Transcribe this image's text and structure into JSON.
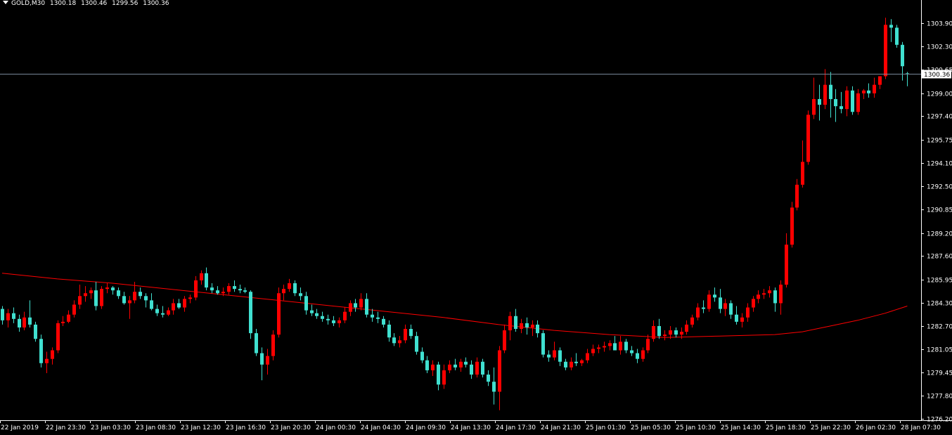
{
  "header": {
    "symbol": "GOLD,M30",
    "open": "1300.18",
    "high": "1300.46",
    "low": "1299.56",
    "close": "1300.36"
  },
  "colors": {
    "background": "#000000",
    "bull": "#ff0000",
    "bear": "#40e0d0",
    "moving_average": "#ff0000",
    "bid_line": "#778899",
    "axis": "#ffffff",
    "text": "#ffffff"
  },
  "chart_data": {
    "type": "candlestick",
    "symbol": "GOLD",
    "timeframe": "M30",
    "ylim": [
      1276.2,
      1304.9
    ],
    "y_ticks": [
      "1303.90",
      "1302.30",
      "1300.65",
      "1299.00",
      "1297.40",
      "1295.75",
      "1294.10",
      "1292.50",
      "1290.85",
      "1289.20",
      "1287.60",
      "1285.95",
      "1284.30",
      "1282.70",
      "1281.05",
      "1279.45",
      "1277.80",
      "1276.20"
    ],
    "x_ticks": [
      "22 Jan 2019",
      "22 Jan 23:30",
      "23 Jan 03:30",
      "23 Jan 08:30",
      "23 Jan 12:30",
      "23 Jan 16:30",
      "23 Jan 20:30",
      "24 Jan 00:30",
      "24 Jan 04:30",
      "24 Jan 09:30",
      "24 Jan 13:30",
      "24 Jan 17:30",
      "24 Jan 21:30",
      "25 Jan 01:30",
      "25 Jan 05:30",
      "25 Jan 10:30",
      "25 Jan 14:30",
      "25 Jan 18:30",
      "25 Jan 22:30",
      "26 Jan 02:30",
      "28 Jan 07:30"
    ],
    "current_price": "1300.36",
    "candles": [
      [
        1283.9,
        1284.1,
        1282.8,
        1283.1
      ],
      [
        1283.1,
        1283.9,
        1282.6,
        1283.6
      ],
      [
        1283.6,
        1284.0,
        1282.9,
        1283.2
      ],
      [
        1283.2,
        1283.5,
        1282.3,
        1282.6
      ],
      [
        1282.6,
        1283.7,
        1282.4,
        1283.3
      ],
      [
        1283.3,
        1284.5,
        1282.6,
        1282.8
      ],
      [
        1282.8,
        1283.0,
        1281.6,
        1281.8
      ],
      [
        1281.8,
        1282.1,
        1279.8,
        1280.1
      ],
      [
        1280.1,
        1280.9,
        1279.4,
        1280.4
      ],
      [
        1280.4,
        1281.2,
        1280.0,
        1281.0
      ],
      [
        1281.0,
        1283.1,
        1280.8,
        1282.9
      ],
      [
        1282.9,
        1283.4,
        1282.7,
        1283.0
      ],
      [
        1283.0,
        1283.8,
        1282.9,
        1283.5
      ],
      [
        1283.5,
        1284.5,
        1283.3,
        1284.2
      ],
      [
        1284.2,
        1285.6,
        1283.9,
        1284.8
      ],
      [
        1284.8,
        1285.5,
        1284.4,
        1285.0
      ],
      [
        1285.0,
        1285.4,
        1284.6,
        1285.2
      ],
      [
        1285.2,
        1285.8,
        1283.8,
        1284.1
      ],
      [
        1284.1,
        1285.5,
        1283.9,
        1285.3
      ],
      [
        1285.3,
        1285.7,
        1285.0,
        1285.4
      ],
      [
        1285.4,
        1285.5,
        1284.9,
        1285.2
      ],
      [
        1285.2,
        1285.4,
        1284.6,
        1284.8
      ],
      [
        1284.8,
        1285.1,
        1284.2,
        1284.3
      ],
      [
        1284.3,
        1284.8,
        1283.2,
        1284.5
      ],
      [
        1284.5,
        1285.8,
        1284.3,
        1285.1
      ],
      [
        1285.1,
        1285.4,
        1284.6,
        1284.8
      ],
      [
        1284.8,
        1285.0,
        1284.0,
        1284.5
      ],
      [
        1284.5,
        1285.0,
        1283.8,
        1283.9
      ],
      [
        1283.9,
        1284.2,
        1283.4,
        1283.6
      ],
      [
        1283.6,
        1284.1,
        1283.3,
        1283.5
      ],
      [
        1283.5,
        1284.0,
        1283.4,
        1283.8
      ],
      [
        1283.8,
        1284.6,
        1283.5,
        1284.3
      ],
      [
        1284.3,
        1284.6,
        1283.9,
        1284.0
      ],
      [
        1284.0,
        1284.8,
        1283.7,
        1284.6
      ],
      [
        1284.6,
        1284.9,
        1284.3,
        1284.7
      ],
      [
        1284.7,
        1286.2,
        1284.5,
        1285.9
      ],
      [
        1285.9,
        1286.6,
        1285.6,
        1286.4
      ],
      [
        1286.4,
        1286.8,
        1285.2,
        1285.4
      ],
      [
        1285.4,
        1285.7,
        1285.0,
        1285.2
      ],
      [
        1285.2,
        1285.5,
        1284.9,
        1285.0
      ],
      [
        1285.0,
        1285.4,
        1284.8,
        1285.1
      ],
      [
        1285.1,
        1285.7,
        1284.9,
        1285.5
      ],
      [
        1285.5,
        1285.9,
        1285.1,
        1285.3
      ],
      [
        1285.3,
        1285.6,
        1285.0,
        1285.2
      ],
      [
        1285.2,
        1285.4,
        1285.0,
        1285.1
      ],
      [
        1285.1,
        1285.2,
        1281.8,
        1282.2
      ],
      [
        1282.2,
        1282.5,
        1280.6,
        1280.8
      ],
      [
        1280.8,
        1281.2,
        1278.9,
        1280.0
      ],
      [
        1280.0,
        1281.1,
        1279.3,
        1280.6
      ],
      [
        1280.6,
        1282.4,
        1280.3,
        1282.1
      ],
      [
        1282.1,
        1285.4,
        1281.9,
        1285.0
      ],
      [
        1285.0,
        1285.6,
        1284.5,
        1285.3
      ],
      [
        1285.3,
        1286.0,
        1285.1,
        1285.7
      ],
      [
        1285.7,
        1285.9,
        1284.8,
        1285.0
      ],
      [
        1285.0,
        1285.4,
        1284.5,
        1284.8
      ],
      [
        1284.8,
        1285.1,
        1283.5,
        1283.8
      ],
      [
        1283.8,
        1284.2,
        1283.4,
        1283.6
      ],
      [
        1283.6,
        1283.9,
        1283.2,
        1283.4
      ],
      [
        1283.4,
        1283.7,
        1283.0,
        1283.2
      ],
      [
        1283.2,
        1283.5,
        1282.8,
        1283.1
      ],
      [
        1283.1,
        1283.4,
        1282.7,
        1282.9
      ],
      [
        1282.9,
        1283.3,
        1282.6,
        1283.1
      ],
      [
        1283.1,
        1284.0,
        1282.9,
        1283.7
      ],
      [
        1283.7,
        1284.5,
        1283.4,
        1284.3
      ],
      [
        1284.3,
        1284.6,
        1283.7,
        1284.0
      ],
      [
        1284.0,
        1285.0,
        1283.8,
        1284.6
      ],
      [
        1284.6,
        1285.0,
        1283.3,
        1283.5
      ],
      [
        1283.5,
        1283.9,
        1283.0,
        1283.3
      ],
      [
        1283.3,
        1283.7,
        1282.9,
        1283.2
      ],
      [
        1283.2,
        1283.4,
        1282.6,
        1282.8
      ],
      [
        1282.8,
        1283.1,
        1281.6,
        1281.9
      ],
      [
        1281.9,
        1282.2,
        1281.3,
        1281.5
      ],
      [
        1281.5,
        1282.0,
        1281.2,
        1281.7
      ],
      [
        1281.7,
        1282.8,
        1281.5,
        1282.5
      ],
      [
        1282.5,
        1282.8,
        1281.8,
        1282.0
      ],
      [
        1282.0,
        1282.3,
        1280.7,
        1280.9
      ],
      [
        1280.9,
        1281.2,
        1280.1,
        1280.3
      ],
      [
        1280.3,
        1280.6,
        1279.4,
        1279.6
      ],
      [
        1279.6,
        1280.3,
        1279.2,
        1280.0
      ],
      [
        1280.0,
        1280.2,
        1278.2,
        1278.6
      ],
      [
        1278.6,
        1280.0,
        1278.3,
        1279.6
      ],
      [
        1279.6,
        1280.3,
        1279.4,
        1280.0
      ],
      [
        1280.0,
        1280.4,
        1279.6,
        1279.8
      ],
      [
        1279.8,
        1280.4,
        1279.5,
        1280.2
      ],
      [
        1280.2,
        1280.5,
        1279.8,
        1280.0
      ],
      [
        1280.0,
        1280.3,
        1279.0,
        1279.3
      ],
      [
        1279.3,
        1280.5,
        1279.1,
        1280.2
      ],
      [
        1280.2,
        1280.4,
        1279.1,
        1279.3
      ],
      [
        1279.3,
        1279.6,
        1278.5,
        1278.8
      ],
      [
        1278.8,
        1279.8,
        1277.2,
        1278.1
      ],
      [
        1278.1,
        1281.3,
        1276.8,
        1281.0
      ],
      [
        1281.0,
        1282.8,
        1280.8,
        1282.4
      ],
      [
        1282.4,
        1283.7,
        1281.7,
        1283.4
      ],
      [
        1283.4,
        1283.9,
        1282.3,
        1282.5
      ],
      [
        1282.5,
        1283.2,
        1282.2,
        1282.9
      ],
      [
        1282.9,
        1283.3,
        1282.1,
        1282.6
      ],
      [
        1282.6,
        1283.1,
        1282.0,
        1282.8
      ],
      [
        1282.8,
        1283.1,
        1281.9,
        1282.2
      ],
      [
        1282.2,
        1282.4,
        1280.5,
        1280.7
      ],
      [
        1280.7,
        1281.0,
        1280.2,
        1280.5
      ],
      [
        1280.5,
        1281.6,
        1280.3,
        1281.0
      ],
      [
        1281.0,
        1281.2,
        1279.9,
        1280.2
      ],
      [
        1280.2,
        1280.4,
        1279.6,
        1279.8
      ],
      [
        1279.8,
        1280.5,
        1279.6,
        1280.2
      ],
      [
        1280.2,
        1280.8,
        1279.9,
        1280.1
      ],
      [
        1280.1,
        1280.4,
        1279.9,
        1280.3
      ],
      [
        1280.3,
        1281.1,
        1280.1,
        1280.8
      ],
      [
        1280.8,
        1281.4,
        1280.6,
        1281.1
      ],
      [
        1281.1,
        1281.4,
        1280.8,
        1281.2
      ],
      [
        1281.2,
        1281.6,
        1280.9,
        1281.3
      ],
      [
        1281.3,
        1281.7,
        1281.0,
        1281.5
      ],
      [
        1281.5,
        1282.0,
        1281.2,
        1281.0
      ],
      [
        1281.0,
        1282.0,
        1280.7,
        1281.6
      ],
      [
        1281.6,
        1281.8,
        1280.8,
        1281.0
      ],
      [
        1281.0,
        1281.3,
        1280.6,
        1280.8
      ],
      [
        1280.8,
        1281.1,
        1280.1,
        1280.4
      ],
      [
        1280.4,
        1281.2,
        1280.2,
        1281.0
      ],
      [
        1281.0,
        1282.1,
        1280.8,
        1281.8
      ],
      [
        1281.8,
        1283.1,
        1281.6,
        1282.7
      ],
      [
        1282.7,
        1283.2,
        1281.8,
        1282.0
      ],
      [
        1282.0,
        1282.4,
        1281.7,
        1282.1
      ],
      [
        1282.1,
        1282.7,
        1281.8,
        1282.4
      ],
      [
        1282.4,
        1282.6,
        1281.9,
        1282.1
      ],
      [
        1282.1,
        1282.6,
        1281.8,
        1282.3
      ],
      [
        1282.3,
        1283.1,
        1282.1,
        1282.8
      ],
      [
        1282.8,
        1283.5,
        1282.6,
        1283.3
      ],
      [
        1283.3,
        1284.3,
        1283.1,
        1284.0
      ],
      [
        1284.0,
        1284.5,
        1283.6,
        1283.9
      ],
      [
        1283.9,
        1285.2,
        1283.7,
        1284.9
      ],
      [
        1284.9,
        1285.4,
        1284.4,
        1284.7
      ],
      [
        1284.7,
        1285.3,
        1283.6,
        1283.9
      ],
      [
        1283.9,
        1284.6,
        1283.4,
        1284.3
      ],
      [
        1284.3,
        1284.5,
        1283.2,
        1283.5
      ],
      [
        1283.5,
        1284.1,
        1282.8,
        1283.0
      ],
      [
        1283.0,
        1283.6,
        1282.6,
        1283.3
      ],
      [
        1283.3,
        1284.3,
        1283.0,
        1284.0
      ],
      [
        1284.0,
        1284.8,
        1283.7,
        1284.6
      ],
      [
        1284.6,
        1285.2,
        1284.3,
        1284.9
      ],
      [
        1284.9,
        1285.3,
        1284.6,
        1285.0
      ],
      [
        1285.0,
        1285.5,
        1284.7,
        1285.2
      ],
      [
        1285.2,
        1285.4,
        1283.7,
        1284.3
      ],
      [
        1284.3,
        1285.9,
        1283.5,
        1285.6
      ],
      [
        1285.6,
        1289.2,
        1285.4,
        1288.4
      ],
      [
        1288.4,
        1291.4,
        1288.2,
        1291.0
      ],
      [
        1291.0,
        1293.0,
        1290.8,
        1292.6
      ],
      [
        1292.6,
        1295.7,
        1292.4,
        1294.2
      ],
      [
        1294.2,
        1297.8,
        1294.0,
        1297.5
      ],
      [
        1297.5,
        1300.1,
        1297.2,
        1298.6
      ],
      [
        1298.6,
        1299.6,
        1297.1,
        1298.2
      ],
      [
        1298.2,
        1300.7,
        1297.9,
        1299.6
      ],
      [
        1299.6,
        1300.5,
        1297.3,
        1298.6
      ],
      [
        1298.6,
        1299.3,
        1297.0,
        1298.1
      ],
      [
        1298.1,
        1299.1,
        1297.6,
        1297.9
      ],
      [
        1297.9,
        1299.5,
        1297.4,
        1299.2
      ],
      [
        1299.2,
        1299.5,
        1297.5,
        1297.7
      ],
      [
        1297.7,
        1299.3,
        1297.5,
        1299.0
      ],
      [
        1299.0,
        1299.3,
        1298.6,
        1299.2
      ],
      [
        1299.2,
        1299.7,
        1298.7,
        1299.0
      ],
      [
        1299.0,
        1300.1,
        1298.7,
        1299.6
      ],
      [
        1299.6,
        1300.0,
        1299.3,
        1300.2
      ],
      [
        1300.2,
        1304.3,
        1300.0,
        1303.8
      ],
      [
        1303.8,
        1304.2,
        1302.6,
        1303.6
      ],
      [
        1303.6,
        1303.8,
        1302.2,
        1302.4
      ],
      [
        1302.4,
        1302.6,
        1299.9,
        1300.9
      ],
      [
        1300.4,
        1300.5,
        1299.5,
        1300.36
      ]
    ],
    "moving_average": {
      "x_index": [
        0,
        10,
        20,
        30,
        40,
        50,
        60,
        70,
        80,
        90,
        95,
        100,
        110,
        120,
        130,
        140,
        145,
        150,
        155,
        160,
        165
      ],
      "values": [
        1286.4,
        1286.0,
        1285.7,
        1285.3,
        1284.9,
        1284.5,
        1284.1,
        1283.7,
        1283.3,
        1282.8,
        1282.6,
        1282.4,
        1282.1,
        1281.9,
        1282.0,
        1282.1,
        1282.3,
        1282.7,
        1283.1,
        1283.6,
        1284.1
      ]
    }
  }
}
